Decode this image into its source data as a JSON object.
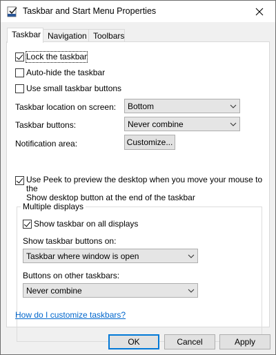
{
  "window": {
    "title": "Taskbar and Start Menu Properties"
  },
  "tabs": [
    {
      "label": "Taskbar",
      "active": true
    },
    {
      "label": "Navigation",
      "active": false
    },
    {
      "label": "Toolbars",
      "active": false
    }
  ],
  "options": {
    "lock_taskbar": {
      "label": "Lock the taskbar",
      "checked": true
    },
    "auto_hide": {
      "label": "Auto-hide the taskbar",
      "checked": false
    },
    "small_buttons": {
      "label": "Use small taskbar buttons",
      "checked": false
    }
  },
  "location": {
    "label": "Taskbar location on screen:",
    "value": "Bottom"
  },
  "buttons_setting": {
    "label": "Taskbar buttons:",
    "value": "Never combine"
  },
  "notification": {
    "label": "Notification area:",
    "button": "Customize..."
  },
  "peek": {
    "line1": "Use Peek to preview the desktop when you move your mouse to the",
    "line2": "Show desktop button at the end of the taskbar",
    "checked": true
  },
  "multiple_displays": {
    "title": "Multiple displays",
    "show_all": {
      "label": "Show taskbar on all displays",
      "checked": true
    },
    "show_buttons_label": "Show taskbar buttons on:",
    "show_buttons_value": "Taskbar where window is open",
    "other_label": "Buttons on other taskbars:",
    "other_value": "Never combine"
  },
  "help_link": "How do I customize taskbars?",
  "footer": {
    "ok": "OK",
    "cancel": "Cancel",
    "apply": "Apply"
  },
  "colors": {
    "accent": "#0078d7",
    "link": "#0066cc"
  }
}
